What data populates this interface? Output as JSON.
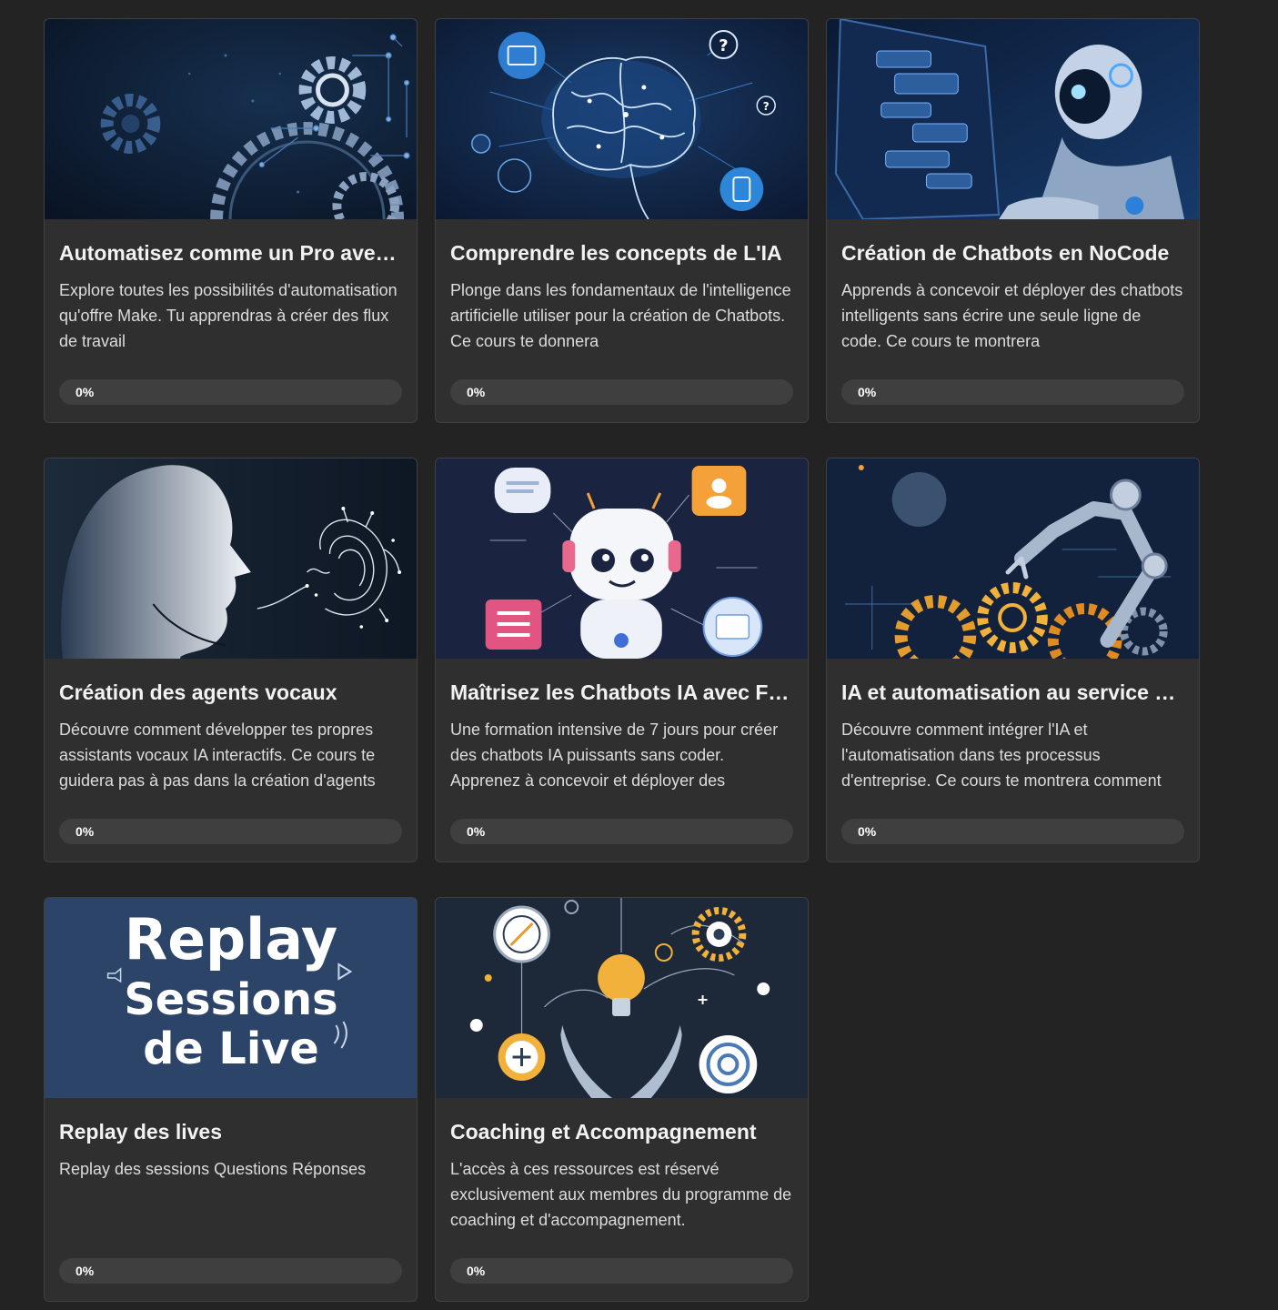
{
  "courses": [
    {
      "title": "Automatisez comme un Pro avec ...",
      "description": "Explore toutes les possibilités d'automatisation qu'offre Make. Tu apprendras à créer des flux de travail",
      "progress_label": "0%",
      "progress": 0,
      "image_icon": "gears-circuit-icon"
    },
    {
      "title": "Comprendre les concepts de L'IA",
      "description": "Plonge dans les fondamentaux de l'intelligence artificielle utiliser pour la création de Chatbots. Ce cours te donnera",
      "progress_label": "0%",
      "progress": 0,
      "image_icon": "brain-network-icon"
    },
    {
      "title": "Création de Chatbots en NoCode",
      "description": "Apprends à concevoir et déployer des chatbots intelligents sans écrire une seule ligne de code. Ce cours te montrera",
      "progress_label": "0%",
      "progress": 0,
      "image_icon": "robot-screen-icon"
    },
    {
      "title": "Création des agents vocaux",
      "description": "Découvre comment développer tes propres assistants vocaux IA interactifs. Ce cours te guidera pas à pas dans la création d'agents",
      "progress_label": "0%",
      "progress": 0,
      "image_icon": "voice-head-icon"
    },
    {
      "title": "Maîtrisez les Chatbots IA avec Flo...",
      "description": "Une formation intensive de 7 jours pour créer des chatbots IA puissants sans coder. Apprenez à concevoir et déployer des",
      "progress_label": "0%",
      "progress": 0,
      "image_icon": "cute-robot-icon"
    },
    {
      "title": "IA et automatisation au service de...",
      "description": "Découvre comment intégrer l'IA et l'automatisation dans tes processus d'entreprise. Ce cours te montrera comment",
      "progress_label": "0%",
      "progress": 0,
      "image_icon": "robot-arm-gears-icon"
    },
    {
      "title": "Replay des lives",
      "description": "Replay des sessions Questions Réponses",
      "progress_label": "0%",
      "progress": 0,
      "image_icon": "replay-banner-icon",
      "image_text": [
        "Replay",
        "Sessions",
        "de Live"
      ]
    },
    {
      "title": "Coaching et Accompagnement",
      "description": "L'accès à ces ressources est réservé exclusivement aux membres du programme de coaching et d'accompagnement.",
      "progress_label": "0%",
      "progress": 0,
      "image_icon": "coaching-lightbulb-icon"
    }
  ],
  "colors": {
    "page_background": "#232323",
    "card_background": "#2f2f2f",
    "progress_track": "#3f3f3f",
    "replay_banner": "#2c4468"
  }
}
